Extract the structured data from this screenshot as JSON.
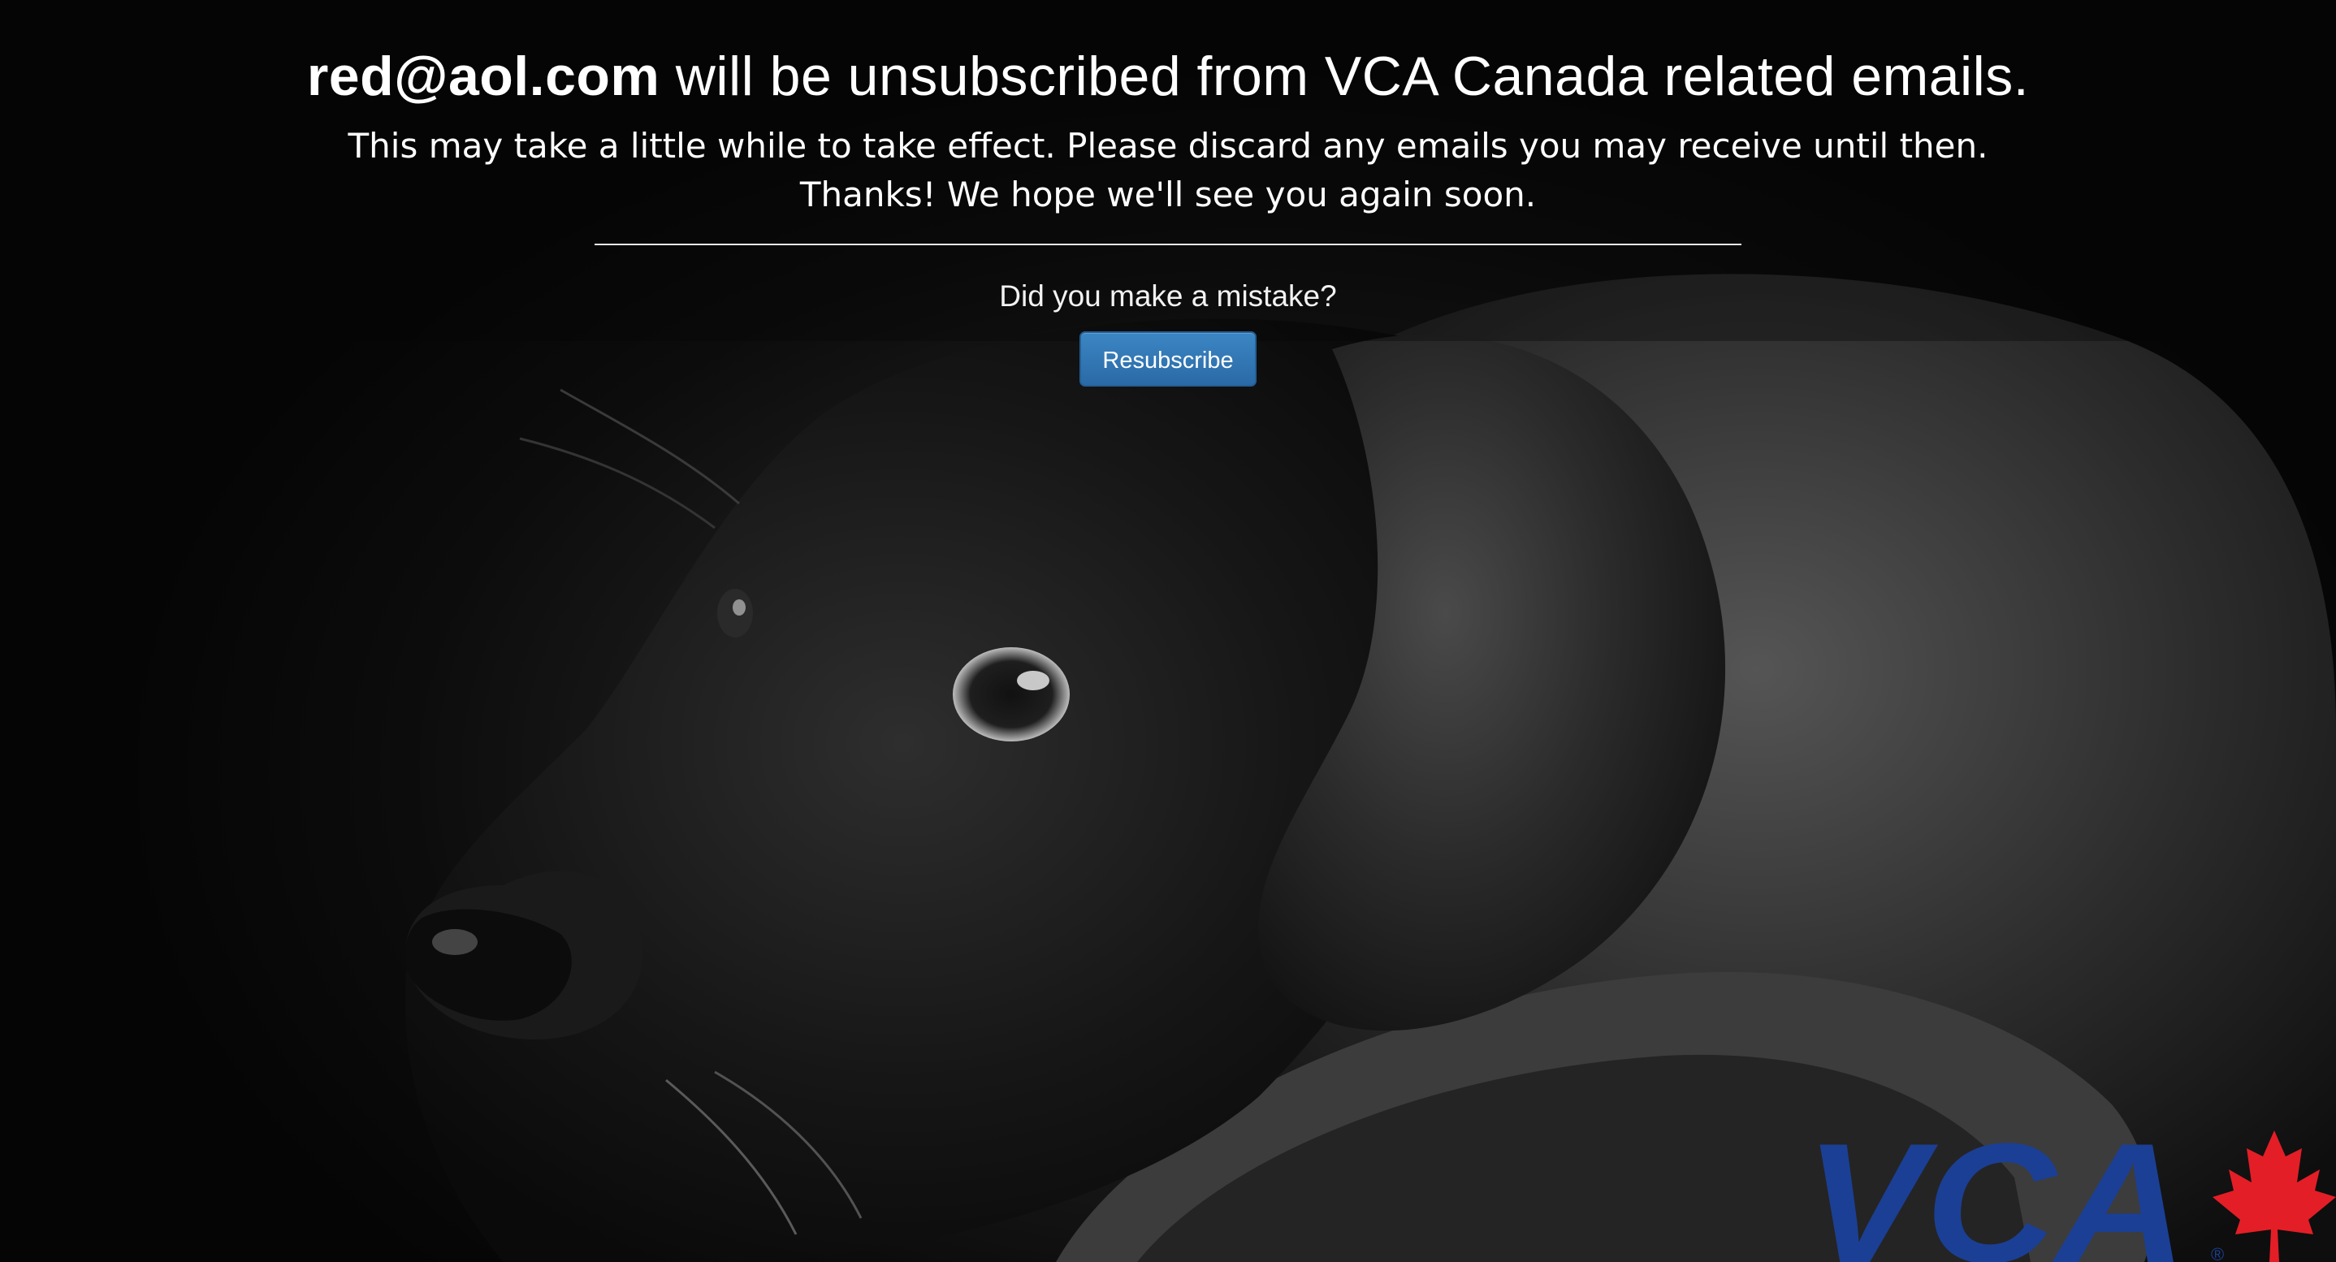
{
  "message": {
    "email": "red@aol.com",
    "headline_rest": " will be unsubscribed from VCA Canada related emails.",
    "line1": "This may take a little while to take effect. Please discard any emails you may receive until then.",
    "line2": "Thanks! We hope we'll see you again soon."
  },
  "prompt": {
    "text": "Did you make a mistake?",
    "button_label": "Resubscribe"
  },
  "logo": {
    "text": "VCA",
    "registered": "®",
    "brand_color": "#1b3f94",
    "leaf_color": "#e41e26",
    "icon": "maple-leaf-icon"
  },
  "background": {
    "image": "black-puppy-photo"
  }
}
